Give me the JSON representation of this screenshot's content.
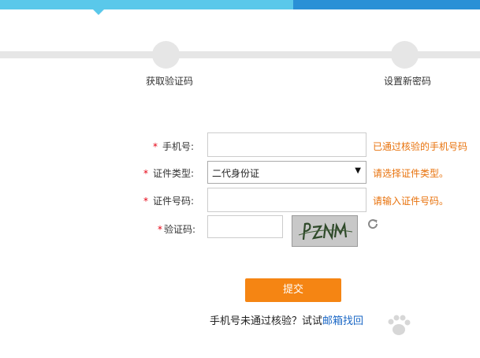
{
  "steps": [
    {
      "label": "获取验证码"
    },
    {
      "label": "设置新密码"
    }
  ],
  "form": {
    "required_mark": "*",
    "phone": {
      "label": "手机号:",
      "value": "",
      "hint": "已通过核验的手机号码"
    },
    "id_type": {
      "label": "证件类型:",
      "selected": "二代身份证",
      "hint": "请选择证件类型。"
    },
    "id_number": {
      "label": "证件号码:",
      "value": "",
      "hint": "请输入证件号码。"
    },
    "captcha": {
      "label": "验证码:",
      "value": "",
      "image_text": "PZNM"
    },
    "submit_label": "提交"
  },
  "footer": {
    "prompt": "手机号未通过核验？试试",
    "link_label": "邮箱找回"
  },
  "colors": {
    "topbar_left": "#5ac8ea",
    "topbar_right": "#2a90d6",
    "required": "#e60012",
    "hint": "#e8720c",
    "submit": "#f58513",
    "link": "#1a67c5"
  },
  "icons": {
    "dropdown": "caret-down-icon",
    "refresh": "refresh-icon"
  }
}
